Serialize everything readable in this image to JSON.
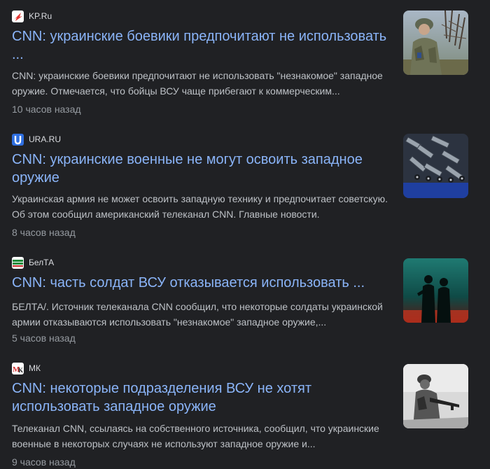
{
  "results": [
    {
      "source": "KP.Ru",
      "title": "CNN: украинские боевики предпочитают не использовать ...",
      "snippet": "CNN: украинские боевики предпочитают не использовать \"незнакомое\" западное оружие. Отмечается, что бойцы ВСУ чаще прибегают к коммерческим...",
      "time": "10 часов назад"
    },
    {
      "source": "URA.RU",
      "title": "CNN: украинские военные не могут освоить западное оружие",
      "snippet": "Украинская армия не может освоить западную технику и предпочитает советскую. Об этом сообщил американский телеканал CNN. Главные новости.",
      "time": "8 часов назад"
    },
    {
      "source": "БелТА",
      "title": "CNN: часть солдат ВСУ отказывается использовать ...",
      "snippet": "БЕЛТА/. Источник телеканала CNN сообщил, что некоторые солдаты украинской армии отказываются использовать \"незнакомое\" западное оружие,...",
      "time": "5 часов назад"
    },
    {
      "source": "МК",
      "title": "CNN: некоторые подразделения ВСУ не хотят использовать западное оружие",
      "snippet": "Телеканал CNN, ссылаясь на собственного источника, сообщил, что украинские военные в некоторых случаях не используют западное оружие и...",
      "time": "9 часов назад"
    }
  ],
  "colors": {
    "background": "#202124",
    "title_link": "#8ab4f8",
    "snippet": "#bdc1c6",
    "time": "#969ba1"
  }
}
